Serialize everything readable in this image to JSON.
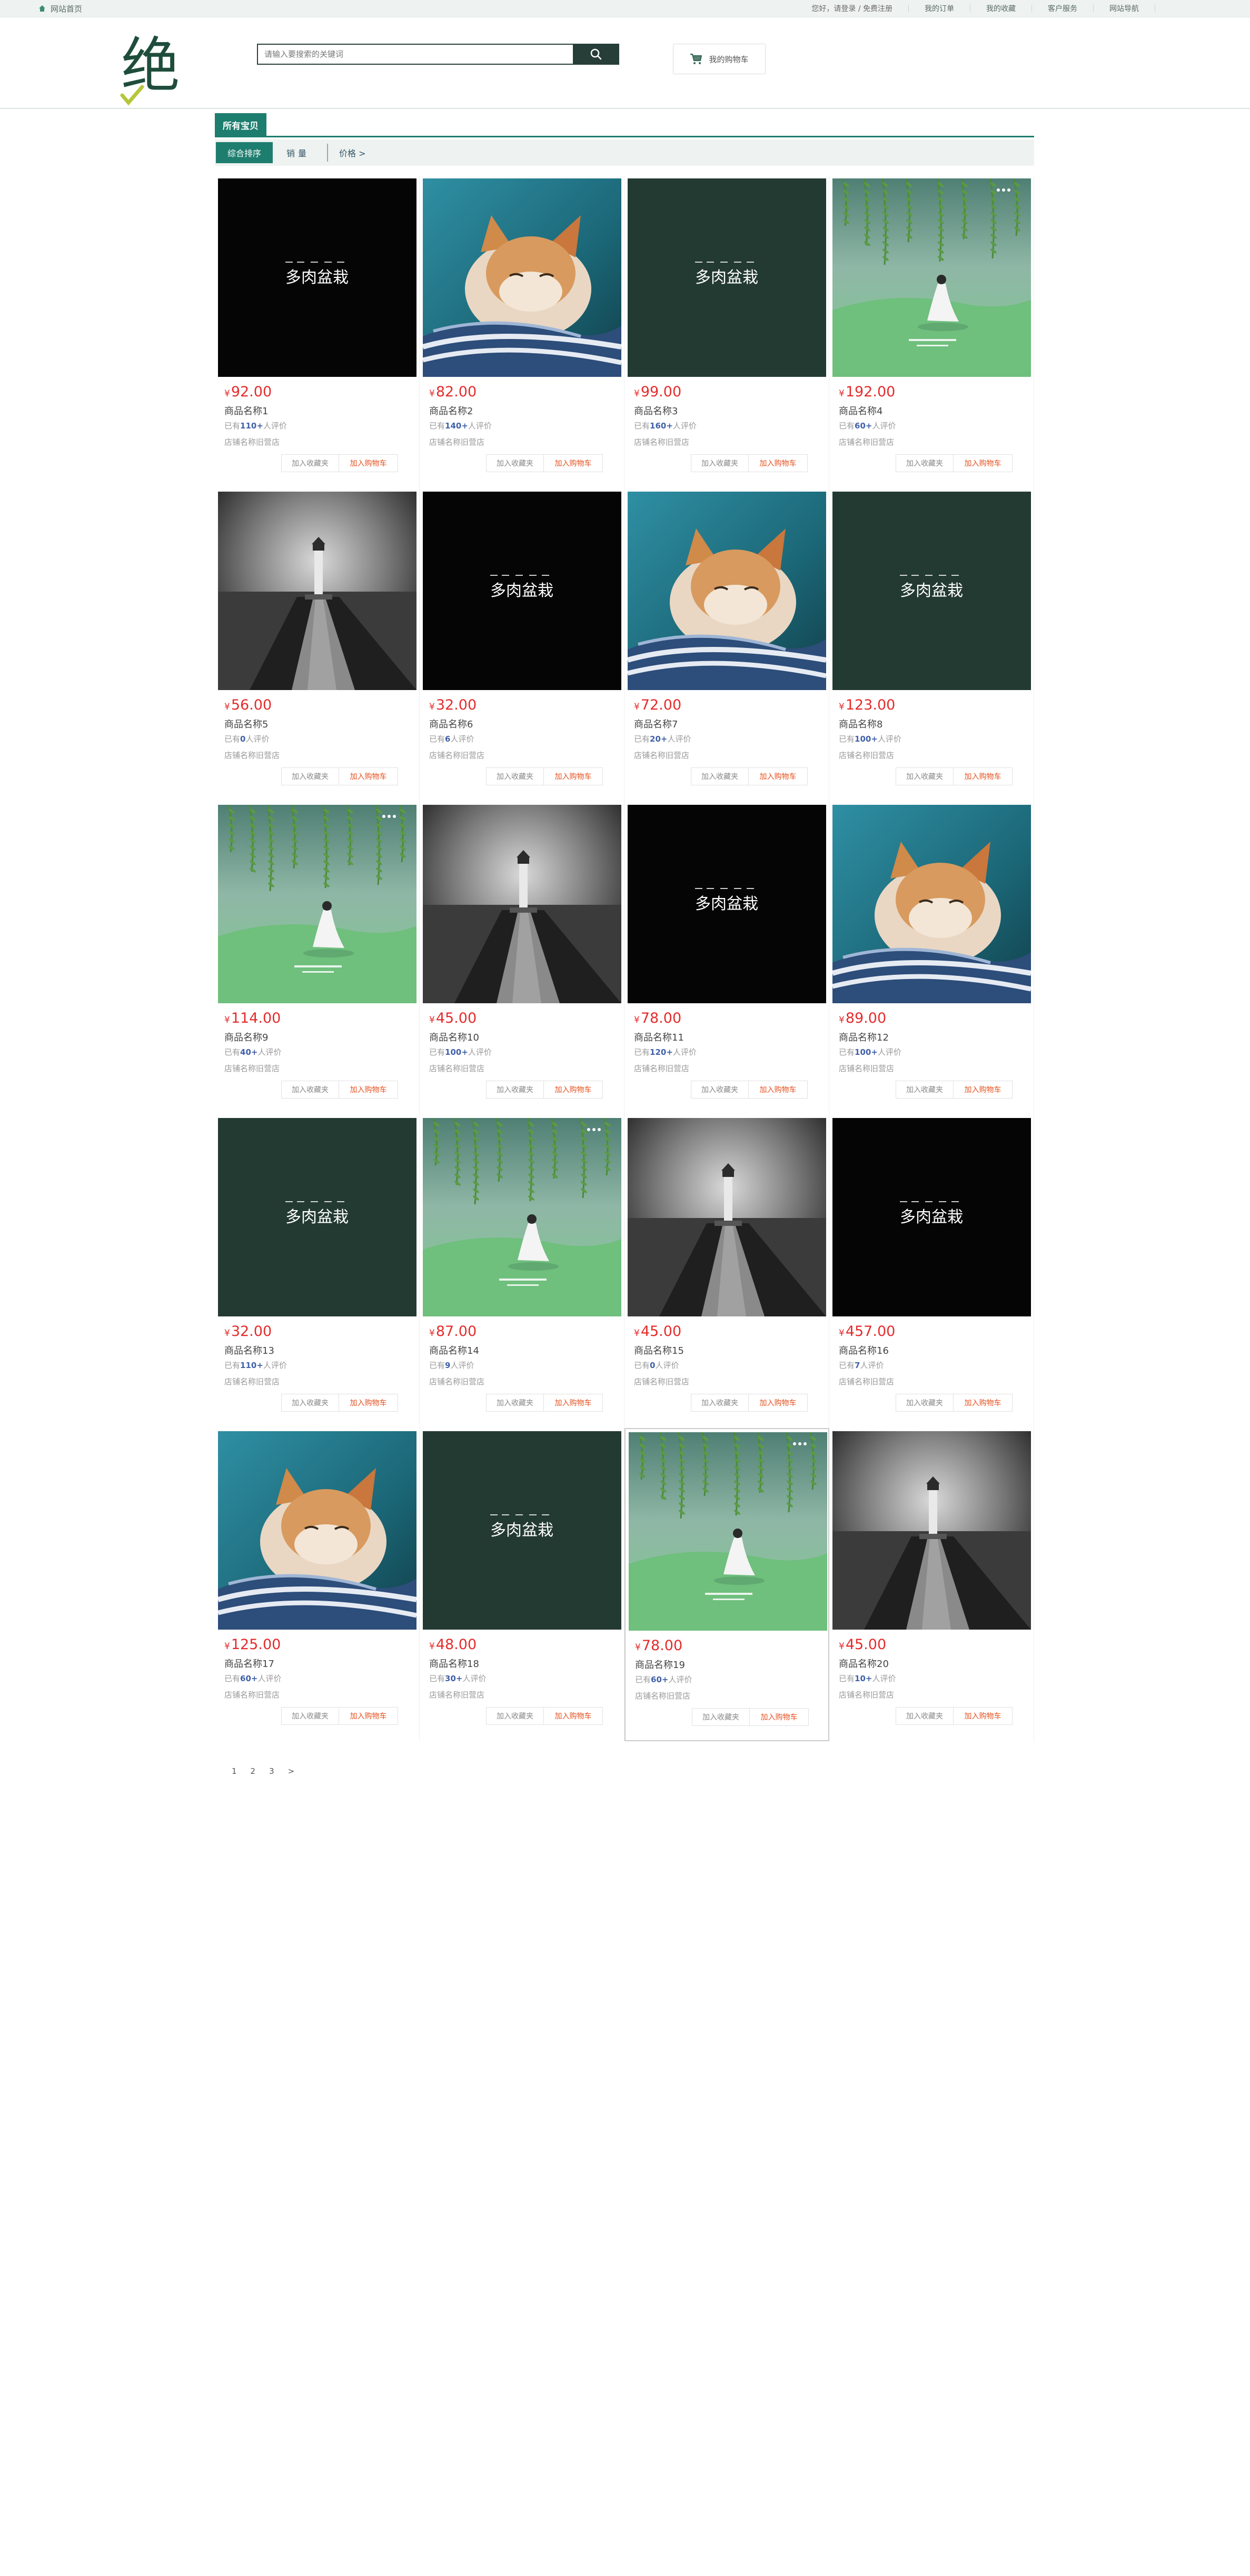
{
  "topbar": {
    "home_label": "网站首页",
    "greeting": "您好，请登录 / 免费注册",
    "links": [
      "我的订单",
      "我的收藏",
      "客户服务",
      "网站导航"
    ]
  },
  "header": {
    "logo_text": "绝",
    "search_placeholder": "请输入要搜索的关键词",
    "cart_label": "我的购物车"
  },
  "category_tab": "所有宝贝",
  "sort": {
    "comprehensive": "综合排序",
    "sales": "销量",
    "price": "价格 >"
  },
  "currency_symbol": "¥",
  "buttons": {
    "favorite": "加入收藏夹",
    "cart": "加入购物车"
  },
  "store_name": "店铺名称旧营店",
  "products": [
    {
      "price": "92.00",
      "name": "商品名称1",
      "sales_prefix": "已有",
      "sales_count": "110+",
      "sales_suffix": "人评价",
      "image": "poster-black"
    },
    {
      "price": "82.00",
      "name": "商品名称2",
      "sales_prefix": "已有",
      "sales_count": "140+",
      "sales_suffix": "人评价",
      "image": "cat"
    },
    {
      "price": "99.00",
      "name": "商品名称3",
      "sales_prefix": "已有",
      "sales_count": "160+",
      "sales_suffix": "人评价",
      "image": "poster-green"
    },
    {
      "price": "192.00",
      "name": "商品名称4",
      "sales_prefix": "已有",
      "sales_count": "60+",
      "sales_suffix": "人评价",
      "image": "willow-girl"
    },
    {
      "price": "56.00",
      "name": "商品名称5",
      "sales_prefix": "已有",
      "sales_count": "0",
      "sales_suffix": "人评价",
      "image": "lighthouse"
    },
    {
      "price": "32.00",
      "name": "商品名称6",
      "sales_prefix": "已有",
      "sales_count": "6",
      "sales_suffix": "人评价",
      "image": "poster-black"
    },
    {
      "price": "72.00",
      "name": "商品名称7",
      "sales_prefix": "已有",
      "sales_count": "20+",
      "sales_suffix": "人评价",
      "image": "cat"
    },
    {
      "price": "123.00",
      "name": "商品名称8",
      "sales_prefix": "已有",
      "sales_count": "100+",
      "sales_suffix": "人评价",
      "image": "poster-green"
    },
    {
      "price": "114.00",
      "name": "商品名称9",
      "sales_prefix": "已有",
      "sales_count": "40+",
      "sales_suffix": "人评价",
      "image": "willow-girl"
    },
    {
      "price": "45.00",
      "name": "商品名称10",
      "sales_prefix": "已有",
      "sales_count": "100+",
      "sales_suffix": "人评价",
      "image": "lighthouse"
    },
    {
      "price": "78.00",
      "name": "商品名称11",
      "sales_prefix": "已有",
      "sales_count": "120+",
      "sales_suffix": "人评价",
      "image": "poster-black"
    },
    {
      "price": "89.00",
      "name": "商品名称12",
      "sales_prefix": "已有",
      "sales_count": "100+",
      "sales_suffix": "人评价",
      "image": "cat"
    },
    {
      "price": "32.00",
      "name": "商品名称13",
      "sales_prefix": "已有",
      "sales_count": "110+",
      "sales_suffix": "人评价",
      "image": "poster-green"
    },
    {
      "price": "87.00",
      "name": "商品名称14",
      "sales_prefix": "已有",
      "sales_count": "9",
      "sales_suffix": "人评价",
      "image": "willow-girl"
    },
    {
      "price": "45.00",
      "name": "商品名称15",
      "sales_prefix": "已有",
      "sales_count": "0",
      "sales_suffix": "人评价",
      "image": "lighthouse"
    },
    {
      "price": "457.00",
      "name": "商品名称16",
      "sales_prefix": "已有",
      "sales_count": "7",
      "sales_suffix": "人评价",
      "image": "poster-black"
    },
    {
      "price": "125.00",
      "name": "商品名称17",
      "sales_prefix": "已有",
      "sales_count": "60+",
      "sales_suffix": "人评价",
      "image": "cat"
    },
    {
      "price": "48.00",
      "name": "商品名称18",
      "sales_prefix": "已有",
      "sales_count": "30+",
      "sales_suffix": "人评价",
      "image": "poster-green"
    },
    {
      "price": "78.00",
      "name": "商品名称19",
      "sales_prefix": "已有",
      "sales_count": "60+",
      "sales_suffix": "人评价",
      "image": "willow-girl",
      "highlighted": true
    },
    {
      "price": "45.00",
      "name": "商品名称20",
      "sales_prefix": "已有",
      "sales_count": "10+",
      "sales_suffix": "人评价",
      "image": "lighthouse"
    }
  ],
  "poster_text": "多肉盆栽",
  "pagination": [
    "1",
    "2",
    "3",
    ">"
  ],
  "colors": {
    "brand_green": "#1d7d6e",
    "dark_green": "#263e37",
    "price_red": "#e52b2b",
    "cart_orange": "#e5501e"
  }
}
